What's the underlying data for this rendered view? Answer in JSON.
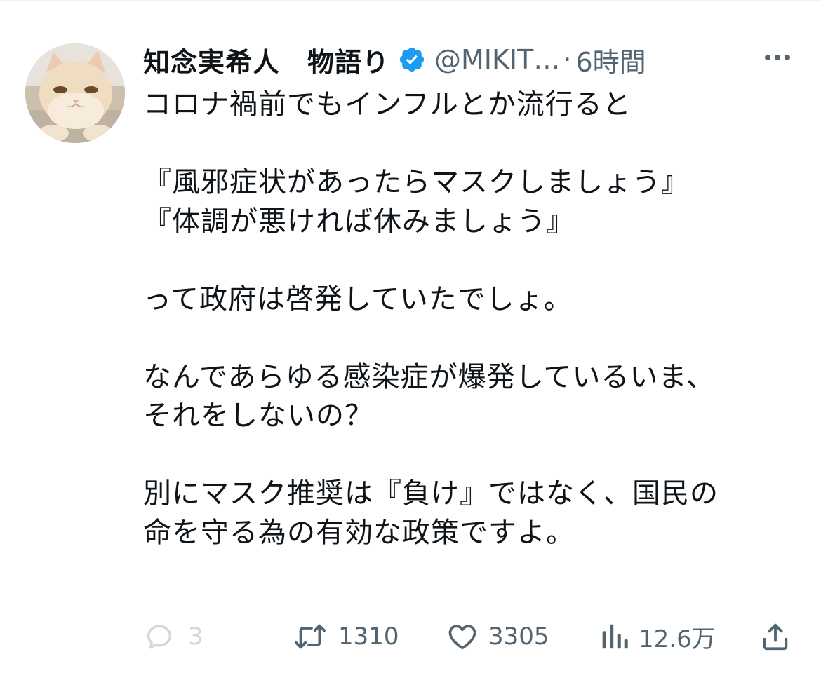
{
  "tweet": {
    "display_name": "知念実希人　物語り",
    "handle": "@MIKIT…",
    "separator": "·",
    "time": "6時間",
    "text": "コロナ禍前でもインフルとか流行ると\n\n『風邪症状があったらマスクしましょう』\n『体調が悪ければ休みましょう』\n\nって政府は啓発していたでしょ。\n\nなんであらゆる感染症が爆発しているいま、\nそれをしないの？\n\n別にマスク推奨は『負け』ではなく、国民の\n命を守る為の有効な政策ですよ。",
    "verified": true,
    "verified_color": "#1d9bf0"
  },
  "actions": {
    "replies": "3",
    "retweets": "1310",
    "likes": "3305",
    "views": "12.6万"
  },
  "icons": {
    "reply": "reply-icon",
    "retweet": "retweet-icon",
    "like": "heart-icon",
    "views": "views-icon",
    "share": "share-icon",
    "more": "more-icon",
    "verified": "verified-badge-icon"
  }
}
